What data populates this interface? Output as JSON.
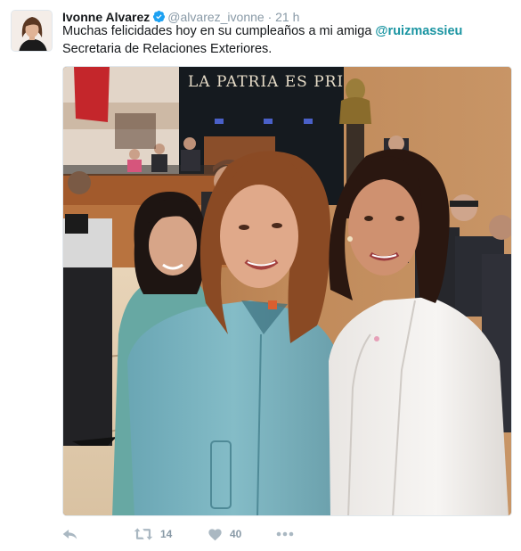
{
  "tweet": {
    "author_name": "Ivonne Alvarez",
    "author_handle": "@alvarez_ivonne",
    "separator": "·",
    "time": "21 h",
    "text_before": "Muchas felicidades hoy en su cumpleaños a mi amiga ",
    "mention": "@ruizmassieu",
    "text_after": " Secretaria de Relaciones Exteriores.",
    "photo_caption_text": "LA PATRIA ES PRI",
    "retweet_count": "14",
    "like_count": "40"
  },
  "icons": {
    "verified": "verified-badge-icon",
    "reply": "reply-icon",
    "retweet": "retweet-icon",
    "like": "heart-icon",
    "more": "more-dots-icon"
  },
  "colors": {
    "mention": "#1b95a2",
    "verified": "#1da1f2",
    "action_icons": "#aab8c2",
    "meta_text": "#8899a6"
  }
}
